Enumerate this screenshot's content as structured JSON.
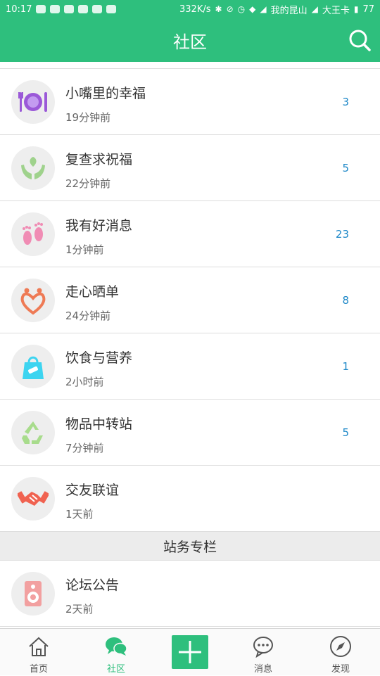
{
  "status_bar": {
    "time": "10:17",
    "speed": "332K/s",
    "carrier1": "我的昆山",
    "carrier2": "大王卡",
    "battery": "77"
  },
  "header": {
    "title": "社区"
  },
  "boards": [
    {
      "name": "小嘴里的幸福",
      "time": "19分钟前",
      "count": "3",
      "icon": "fork-plate-knife-icon"
    },
    {
      "name": "复查求祝福",
      "time": "22分钟前",
      "count": "5",
      "icon": "hands-leaf-icon"
    },
    {
      "name": "我有好消息",
      "time": "1分钟前",
      "count": "23",
      "icon": "baby-feet-icon"
    },
    {
      "name": "走心晒单",
      "time": "24分钟前",
      "count": "8",
      "icon": "heart-people-icon"
    },
    {
      "name": "饮食与营养",
      "time": "2小时前",
      "count": "1",
      "icon": "shopping-bag-icon"
    },
    {
      "name": "物品中转站",
      "time": "7分钟前",
      "count": "5",
      "icon": "recycle-icon"
    },
    {
      "name": "交友联谊",
      "time": "1天前",
      "count": "",
      "icon": "handshake-icon"
    }
  ],
  "section_title": "站务专栏",
  "notice": {
    "name": "论坛公告",
    "time": "2天前",
    "icon": "speaker-icon"
  },
  "tabs": [
    {
      "label": "首页",
      "icon": "home-icon"
    },
    {
      "label": "社区",
      "icon": "chat-bubbles-icon"
    },
    {
      "label": "",
      "icon": "plus-icon"
    },
    {
      "label": "消息",
      "icon": "message-icon"
    },
    {
      "label": "发现",
      "icon": "compass-icon"
    }
  ],
  "colors": {
    "accent": "#2ebf7d",
    "count": "#1e88c8"
  }
}
